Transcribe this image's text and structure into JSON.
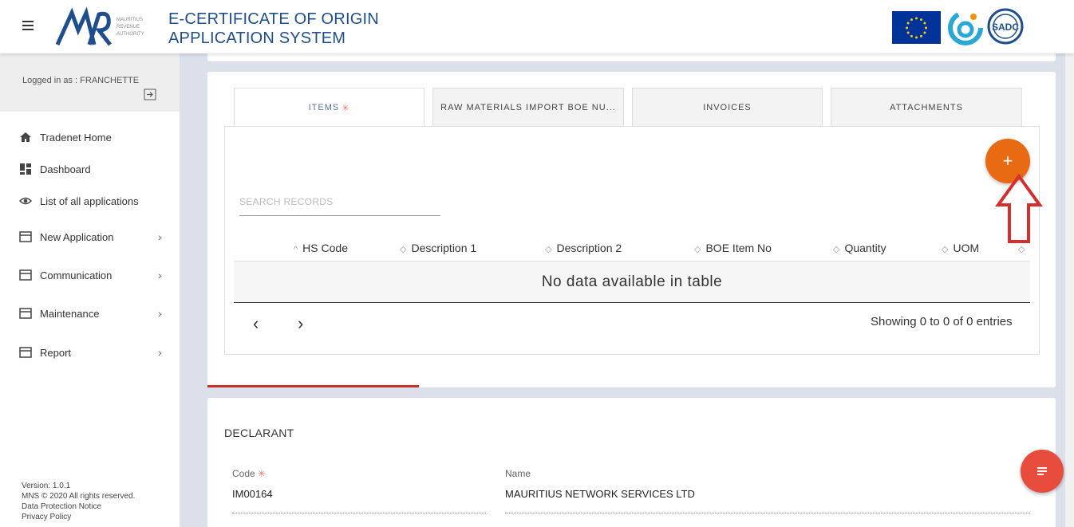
{
  "header": {
    "title_line1": "E-CERTIFICATE OF ORIGIN",
    "title_line2": "APPLICATION SYSTEM",
    "mra_logo_text": [
      "MAURITIUS",
      "REVENUE",
      "AUTHORITY"
    ],
    "sadc_logo_text": "SADC"
  },
  "sidebar": {
    "logged_in": "Logged in as : FRANCHETTE",
    "items": [
      {
        "label": "Tradenet Home",
        "icon": "home-icon"
      },
      {
        "label": "Dashboard",
        "icon": "dashboard-icon"
      },
      {
        "label": "List of all applications",
        "icon": "eye-icon"
      },
      {
        "label": "New Application",
        "icon": "card-icon",
        "chevron": "›"
      },
      {
        "label": "Communication",
        "icon": "card-icon",
        "chevron": "›"
      },
      {
        "label": "Maintenance",
        "icon": "card-icon",
        "chevron": "›"
      },
      {
        "label": "Report",
        "icon": "card-icon",
        "chevron": "›"
      }
    ],
    "footer": {
      "version": "Version: 1.0.1",
      "copyright": "MNS © 2020 All rights reserved.",
      "data_protection": "Data Protection Notice",
      "privacy": "Privacy Policy"
    }
  },
  "tabs": [
    {
      "label": "ITEMS",
      "required": "✳",
      "active": true
    },
    {
      "label": "RAW MATERIALS IMPORT BOE NU...",
      "active": false
    },
    {
      "label": "INVOICES",
      "active": false
    },
    {
      "label": "ATTACHMENTS",
      "active": false
    }
  ],
  "table": {
    "search_placeholder": "SEARCH RECORDS",
    "add_button": "+",
    "columns": [
      {
        "label": "HS Code",
        "sort": "^"
      },
      {
        "label": "Description 1",
        "sort": "◇"
      },
      {
        "label": "Description 2",
        "sort": "◇"
      },
      {
        "label": "BOE Item No",
        "sort": "◇"
      },
      {
        "label": "Quantity",
        "sort": "◇"
      },
      {
        "label": "UOM",
        "sort": "◇"
      },
      {
        "label": "",
        "sort": "◇"
      }
    ],
    "empty_message": "No data available in table",
    "prev": "‹",
    "next": "›",
    "showing": "Showing 0 to 0 of 0 entries"
  },
  "declarant": {
    "section_title": "DECLARANT",
    "code_label": "Code",
    "code_required": "✳",
    "code_value": "IM00164",
    "name_label": "Name",
    "name_value": "MAURITIUS NETWORK SERVICES LTD"
  },
  "colors": {
    "accent_orange": "#e86a12",
    "fab_red": "#e74c3c",
    "title_blue": "#1f4e8c",
    "annotation_red": "#d32f2f"
  }
}
